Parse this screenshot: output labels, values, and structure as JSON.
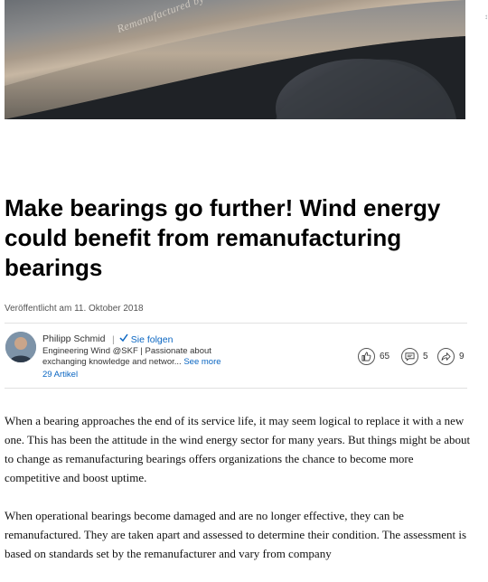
{
  "hero": {
    "engraving_text": "Remanufactured by"
  },
  "article": {
    "title": "Make bearings go further! Wind energy could benefit from remanufacturing bearings",
    "published": "Veröffentlicht am 11. Oktober 2018"
  },
  "author": {
    "name": "Philipp Schmid",
    "follow_label": "Sie folgen",
    "bio": "Engineering Wind @SKF | Passionate about exchanging knowledge and networ...",
    "see_more": "See more",
    "articles": "29 Artikel"
  },
  "stats": {
    "likes": "65",
    "comments": "5",
    "shares": "9"
  },
  "body": {
    "p1": "When a bearing approaches the end of its service life, it may seem logical to replace it with a new one. This has been the attitude in the wind energy sector for many years. But things might be about to change as remanufacturing bearings offers organizations the chance to become more competitive and boost uptime.",
    "p2": "When operational bearings become damaged and are no longer effective, they can be remanufactured. They are taken apart and assessed to determine their condition. The assessment is based on standards set by the remanufacturer and vary from company"
  },
  "icons": {
    "like": "thumbs-up-icon",
    "comment": "comment-icon",
    "share": "share-icon",
    "check": "check-icon"
  }
}
